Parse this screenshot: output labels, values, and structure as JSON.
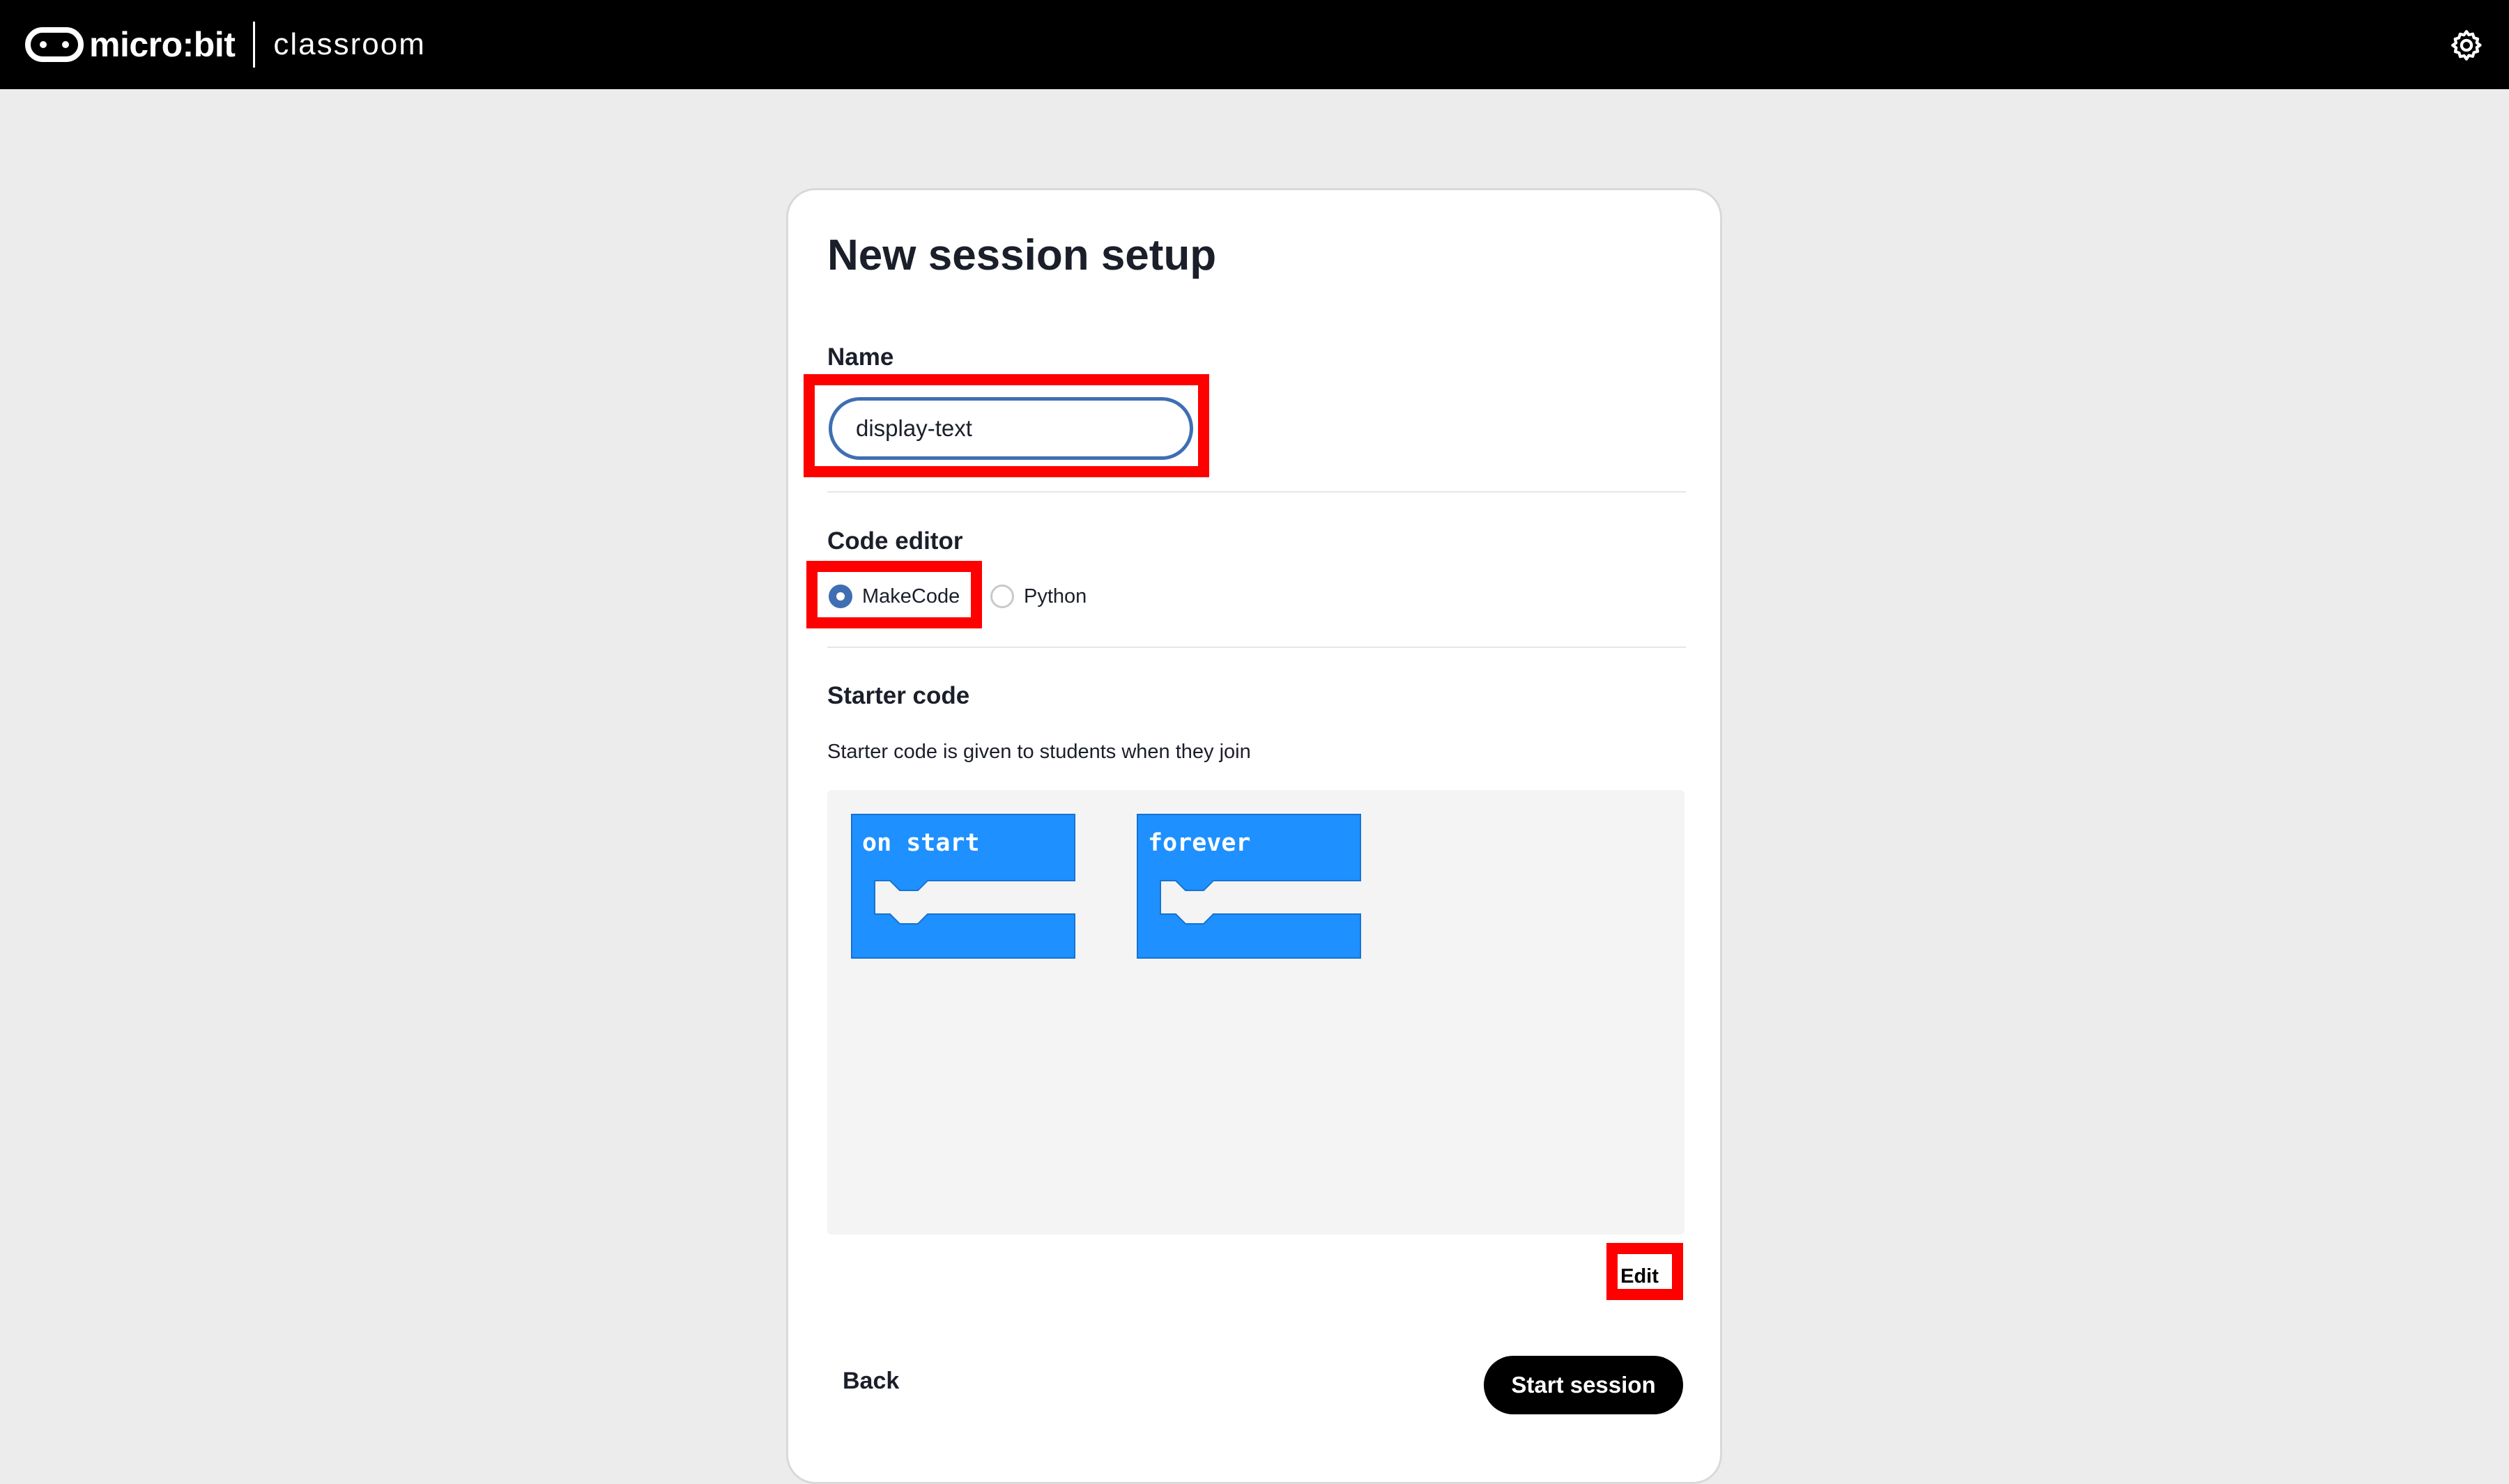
{
  "header": {
    "brand_name": "micro:bit",
    "product_name": "classroom",
    "settings_icon": "gear-icon"
  },
  "form": {
    "title": "New session setup",
    "name": {
      "label": "Name",
      "value": "display-text"
    },
    "code_editor": {
      "label": "Code editor",
      "options": [
        {
          "label": "MakeCode",
          "selected": true
        },
        {
          "label": "Python",
          "selected": false
        }
      ]
    },
    "starter_code": {
      "label": "Starter code",
      "helper": "Starter code is given to students when they join",
      "blocks": [
        {
          "label": "on start"
        },
        {
          "label": "forever"
        }
      ],
      "edit_label": "Edit"
    },
    "back_label": "Back",
    "start_label": "Start session"
  },
  "colors": {
    "accent": "#3f6eb3",
    "block": "#1e90ff",
    "highlight": "#ff0000"
  }
}
